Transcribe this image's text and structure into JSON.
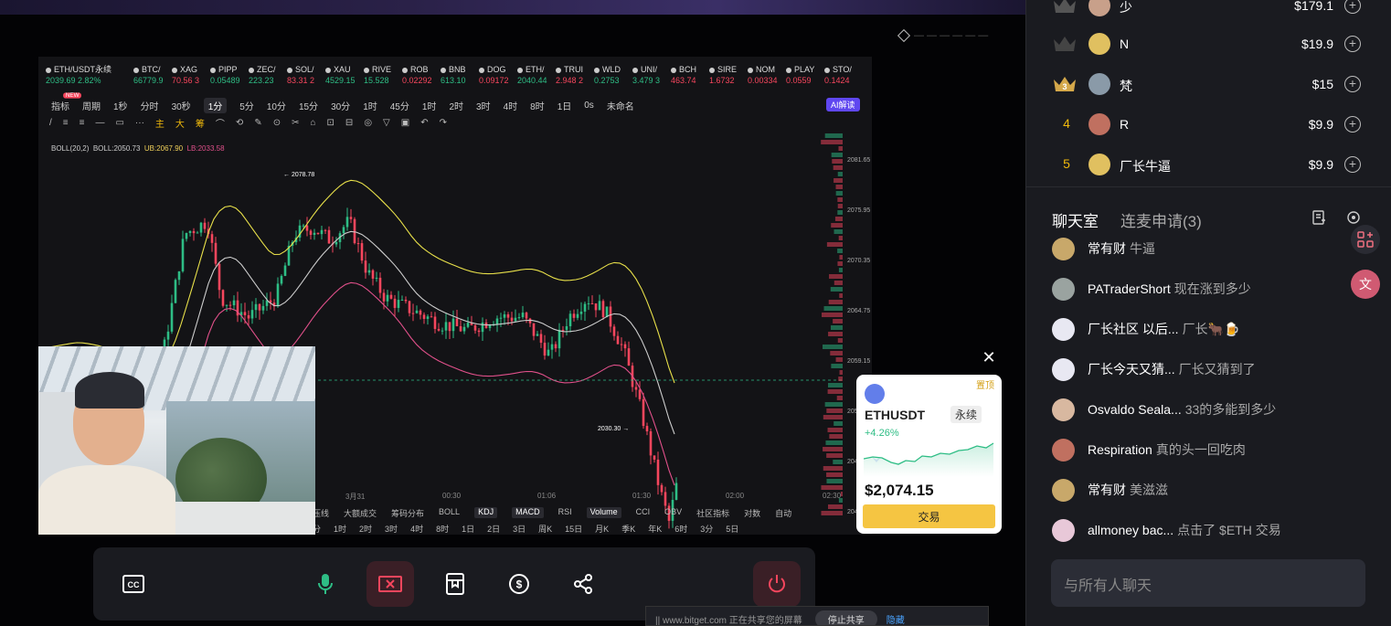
{
  "stage": {
    "watermark": "— — — — — —"
  },
  "tv": {
    "tickers": [
      {
        "name": "ETH/USDT永续",
        "value": "2039.69 2.82%",
        "dir": "up"
      },
      {
        "name": "BTC/",
        "value": "66779.9",
        "dir": "up"
      },
      {
        "name": "XAG",
        "value": "70.56 3",
        "dir": "dn"
      },
      {
        "name": "PIPP",
        "value": "0.05489",
        "dir": "up"
      },
      {
        "name": "ZEC/",
        "value": "223.23",
        "dir": "up"
      },
      {
        "name": "SOL/",
        "value": "83.31 2",
        "dir": "dn"
      },
      {
        "name": "XAU",
        "value": "4529.15",
        "dir": "up"
      },
      {
        "name": "RIVE",
        "value": "15.528",
        "dir": "up"
      },
      {
        "name": "ROB",
        "value": "0.02292",
        "dir": "dn"
      },
      {
        "name": "BNB",
        "value": "613.10",
        "dir": "up"
      },
      {
        "name": "DOG",
        "value": "0.09172",
        "dir": "dn"
      },
      {
        "name": "ETH/",
        "value": "2040.44",
        "dir": "up"
      },
      {
        "name": "TRUI",
        "value": "2.948 2",
        "dir": "dn"
      },
      {
        "name": "WLD",
        "value": "0.2753",
        "dir": "up"
      },
      {
        "name": "UNI/",
        "value": "3.479 3",
        "dir": "up"
      },
      {
        "name": "BCH",
        "value": "463.74",
        "dir": "dn"
      },
      {
        "name": "SIRE",
        "value": "1.6732",
        "dir": "dn"
      },
      {
        "name": "NOM",
        "value": "0.00334",
        "dir": "dn"
      },
      {
        "name": "PLAY",
        "value": "0.0559",
        "dir": "dn"
      },
      {
        "name": "STO/",
        "value": "0.1424",
        "dir": "dn"
      }
    ],
    "new_tag": "NEW",
    "timeframes": [
      "指标",
      "周期",
      "1秒",
      "分时",
      "30秒",
      "1分",
      "5分",
      "10分",
      "15分",
      "30分",
      "1时",
      "45分",
      "1时",
      "2时",
      "3时",
      "4时",
      "8时",
      "1日",
      "0s",
      "未命名"
    ],
    "ai_label": "AI解读",
    "tools": [
      "主",
      "大",
      "筹"
    ],
    "indicator": {
      "name": "BOLL(20,2)",
      "boll": "BOLL:2050.73",
      "ub": "UB:2067.90",
      "lb": "LB:2033.58"
    },
    "price_axis": [
      "2081.65",
      "2075.95",
      "2070.35",
      "2064.75",
      "2059.15",
      "2053.55",
      "2047.95",
      "2042.35"
    ],
    "x_axis": [
      {
        "label": "3月31"
      },
      {
        "label": "00:30"
      },
      {
        "label": "01:06"
      },
      {
        "label": "01:30"
      },
      {
        "label": "02:00"
      },
      {
        "label": "02:30"
      }
    ],
    "high_label": "← 2078.78",
    "low_label": "2030.30 →",
    "bottom_tabs": [
      "压线",
      "大额成交",
      "筹码分布",
      "BOLL",
      "KDJ",
      "MACD",
      "RSI",
      "Volume",
      "CCI",
      "OBV",
      "社区指标",
      "对数",
      "自动"
    ],
    "bottom_tf": [
      "分",
      "1时",
      "2时",
      "3时",
      "4时",
      "8时",
      "1日",
      "2日",
      "3日",
      "周K",
      "15日",
      "月K",
      "季K",
      "年K",
      "6时",
      "3分",
      "5日"
    ]
  },
  "card": {
    "pin": "置顶",
    "symbol": "ETHUSDT",
    "type": "永续",
    "change": "+4.26%",
    "price": "$2,074.15",
    "trade": "交易"
  },
  "strip": {
    "text": "|| www.bitget.com 正在共享您的屏幕",
    "stop": "停止共享",
    "hide": "隐藏"
  },
  "rank": [
    {
      "pos": "",
      "name": "少",
      "amount": "$179.1"
    },
    {
      "pos": "",
      "name": "N",
      "amount": "$19.9"
    },
    {
      "pos": "3",
      "name": "梵",
      "amount": "$15"
    },
    {
      "pos": "4",
      "name": "R",
      "amount": "$9.9"
    },
    {
      "pos": "5",
      "name": "厂长牛逼",
      "amount": "$9.9"
    }
  ],
  "chat": {
    "tab1": "聊天室",
    "tab2": "连麦申请(3)",
    "messages": [
      {
        "user": "常有财",
        "text": "牛逼",
        "color": "#c8a86a"
      },
      {
        "user": "PATraderShort",
        "text": "现在涨到多少",
        "color": "#9aa3a0"
      },
      {
        "user": "厂长社区 以后...",
        "text": "厂长🐂🍺",
        "color": "#e8e8f2"
      },
      {
        "user": "厂长今天又猜...",
        "text": "厂长又猜到了",
        "color": "#e8e8f2"
      },
      {
        "user": "Osvaldo Seala...",
        "text": "33的多能到多少",
        "color": "#d8b8a0"
      },
      {
        "user": "Respiration",
        "text": "真的头一回吃肉",
        "color": "#c07060"
      },
      {
        "user": "常有财",
        "text": "美滋滋",
        "color": "#c8a86a"
      },
      {
        "user": "allmoney bac...",
        "text": "点击了 $ETH 交易",
        "color": "#e8c8d8"
      }
    ],
    "placeholder": "与所有人聊天"
  },
  "colors": {
    "up": "#2ebd85",
    "down": "#f6465d",
    "mid": "#cccccc",
    "upper": "#e8e04a",
    "lower": "#e0508a",
    "accent": "#f5c542"
  }
}
